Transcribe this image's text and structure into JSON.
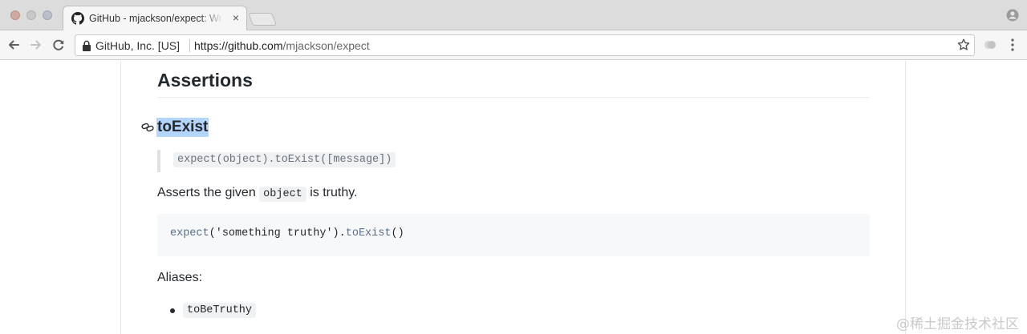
{
  "window": {
    "traffic_lights": [
      "close",
      "minimize",
      "zoom"
    ]
  },
  "tab": {
    "title": "GitHub - mjackson/expect: Wr",
    "favicon": "github-icon",
    "close_glyph": "×"
  },
  "toolbar": {
    "secure_label": "GitHub, Inc. [US]",
    "url_scheme_host": "https://github.com",
    "url_path": "/mjackson/expect"
  },
  "article": {
    "heading": "Assertions",
    "method_heading": "toExist",
    "signature": "expect(object).toExist([message])",
    "description_before": "Asserts the given ",
    "description_code": "object",
    "description_after": " is truthy.",
    "example_fn": "expect",
    "example_open": "(",
    "example_arg": "'something truthy'",
    "example_mid": ").",
    "example_method": "toExist",
    "example_close": "()",
    "aliases_label": "Aliases:",
    "aliases": [
      "toBeTruthy"
    ]
  },
  "watermark": "@稀土掘金技术社区",
  "colors": {
    "selection": "#b4d5fe",
    "code_bg": "#f6f8fa",
    "text": "#24292e"
  }
}
